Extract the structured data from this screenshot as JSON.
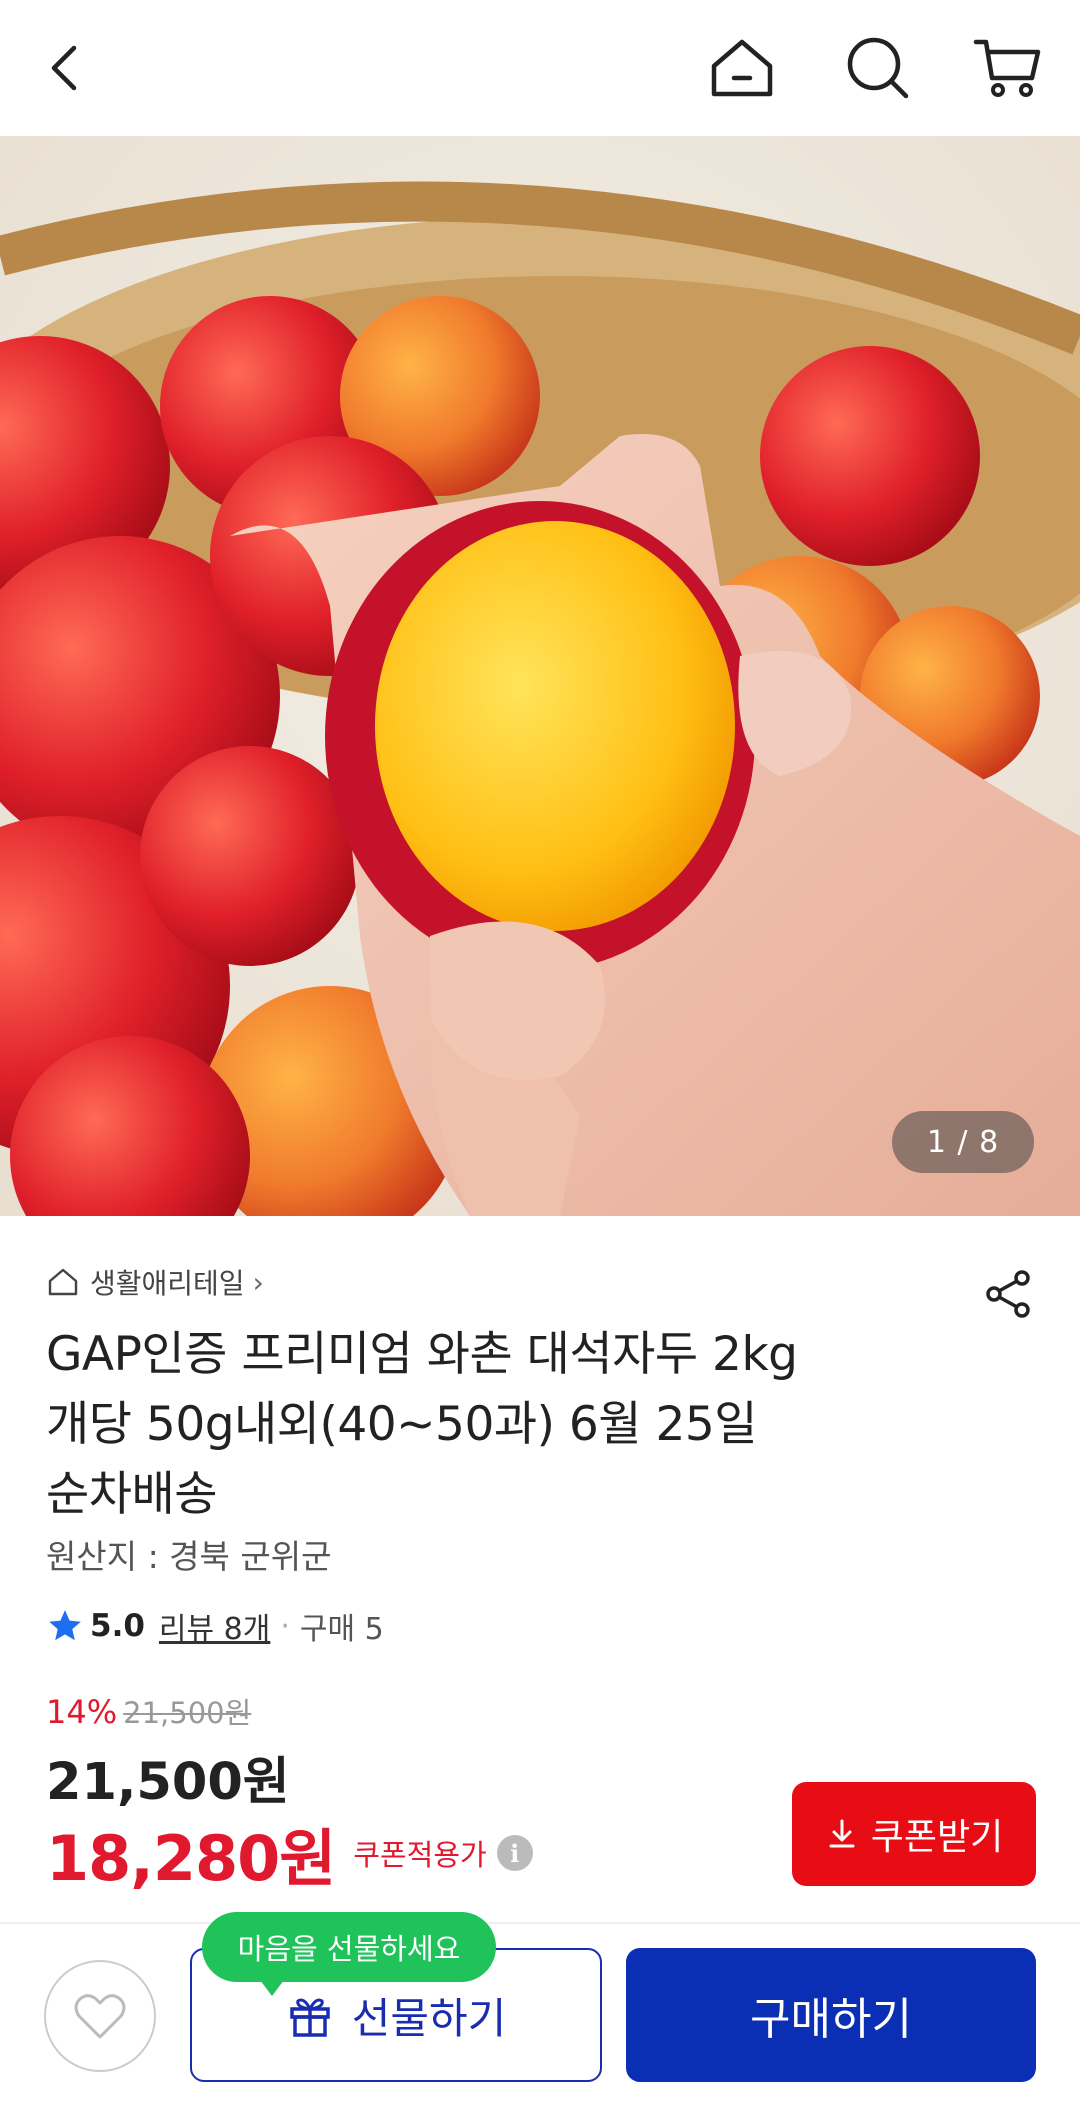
{
  "header": {
    "back_icon": "chevron-left-icon",
    "home_icon": "home-icon",
    "search_icon": "search-icon",
    "cart_icon": "cart-icon"
  },
  "gallery": {
    "pager": "1 / 8",
    "current_page": 1,
    "total_pages": 8
  },
  "product": {
    "category": "생활애리테일",
    "title_lines": [
      "GAP인증 프리미엄 와촌 대석자두 2kg",
      "개당 50g내외(40~50과) 6월 25일",
      "순차배송"
    ],
    "origin": "원산지 : 경북 군위군",
    "rating": "5.0",
    "review": "리뷰 8개",
    "purchase": "구매 5"
  },
  "price": {
    "discount": "14%",
    "original": "21,500원",
    "price": "21,500원",
    "coupon_price": "18,280원",
    "coupon_label": "쿠폰적용가",
    "coupon_button": "쿠폰받기"
  },
  "bottom": {
    "gift_tooltip": "마음을 선물하세요",
    "gift_button": "선물하기",
    "buy_button": "구매하기"
  },
  "colors": {
    "accent_red": "#e0192f",
    "primary_blue": "#0a2fb4",
    "tooltip_green": "#1fc35a"
  }
}
